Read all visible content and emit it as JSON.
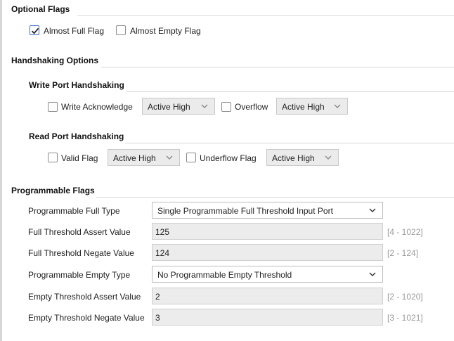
{
  "optional_flags": {
    "title": "Optional Flags",
    "almost_full": {
      "label": "Almost Full Flag",
      "checked": true
    },
    "almost_empty": {
      "label": "Almost Empty Flag",
      "checked": false
    }
  },
  "handshaking": {
    "title": "Handshaking Options",
    "write_port": {
      "title": "Write Port Handshaking",
      "write_ack": {
        "label": "Write Acknowledge",
        "checked": false,
        "level": "Active High"
      },
      "overflow": {
        "label": "Overflow",
        "checked": false,
        "level": "Active High"
      }
    },
    "read_port": {
      "title": "Read Port Handshaking",
      "valid": {
        "label": "Valid Flag",
        "checked": false,
        "level": "Active High"
      },
      "underflow": {
        "label": "Underflow Flag",
        "checked": false,
        "level": "Active High"
      }
    }
  },
  "programmable": {
    "title": "Programmable Flags",
    "full_type": {
      "label": "Programmable Full Type",
      "value": "Single Programmable Full Threshold Input Port"
    },
    "full_assert": {
      "label": "Full Threshold Assert Value",
      "value": "125",
      "range": "[4 - 1022]"
    },
    "full_negate": {
      "label": "Full Threshold Negate Value",
      "value": "124",
      "range": "[2 - 124]"
    },
    "empty_type": {
      "label": "Programmable Empty Type",
      "value": "No Programmable Empty Threshold"
    },
    "empty_assert": {
      "label": "Empty Threshold Assert Value",
      "value": "2",
      "range": "[2 - 1020]"
    },
    "empty_negate": {
      "label": "Empty Threshold Negate Value",
      "value": "3",
      "range": "[3 - 1021]"
    }
  },
  "icons": {
    "checkmark": "check-icon",
    "dropdown": "chevron-down-icon"
  },
  "colors": {
    "check_accent": "#3a6fd0",
    "disabled_field": "#ececec",
    "range_text": "#9a9a9a"
  }
}
